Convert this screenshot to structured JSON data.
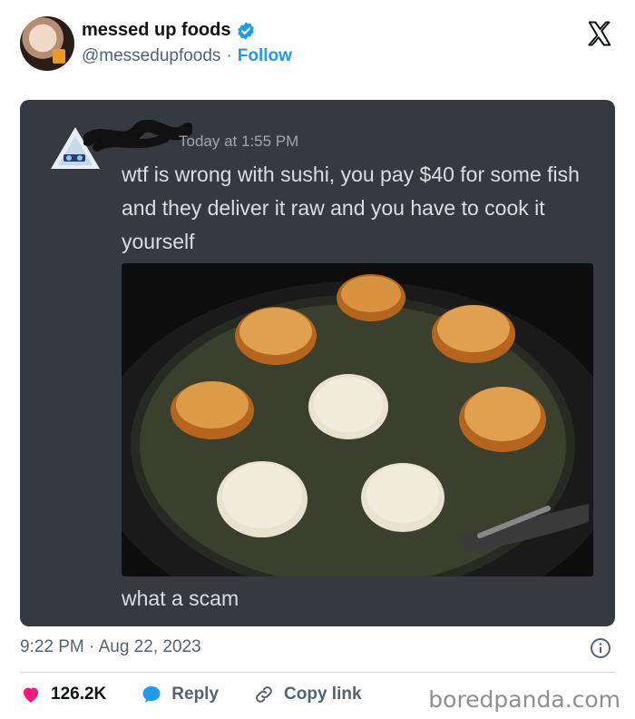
{
  "account": {
    "display_name": "messed up foods",
    "handle": "@messedupfoods",
    "separator": "·",
    "follow_label": "Follow",
    "verified_color": "#1d9bf0"
  },
  "embedded_message": {
    "timestamp": "Today at 1:55 PM",
    "text": "wtf is wrong with sushi, you pay $40 for some fish and they deliver it raw and you have to cook it yourself",
    "caption": "what a scam",
    "image_subject": "sushi rolls being fried in oil in a black pan"
  },
  "post_meta": {
    "time": "9:22 PM · Aug 22, 2023"
  },
  "actions": {
    "likes": "126.2K",
    "reply_label": "Reply",
    "copy_link_label": "Copy link"
  },
  "watermark": "boredpanda.com",
  "colors": {
    "discord_bg": "#36393f",
    "like_red": "#f91880",
    "reply_blue": "#1d9bf0",
    "muted": "#536471"
  }
}
